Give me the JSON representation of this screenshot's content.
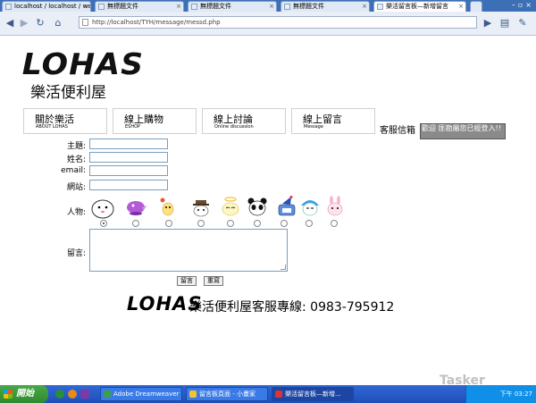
{
  "browser": {
    "tabs": [
      {
        "label": "localhost / localhost / we..."
      },
      {
        "label": "無標題文件"
      },
      {
        "label": "無標題文件"
      },
      {
        "label": "無標題文件"
      },
      {
        "label": "樂活留言板—新增留言"
      }
    ],
    "url": "http://localhost/TYH/message/messd.php"
  },
  "header": {
    "logo": "LOHAS",
    "subtitle": "樂活便利屋"
  },
  "nav": [
    {
      "zh": "關於樂活",
      "en": "ABOUT LOHAS"
    },
    {
      "zh": "線上購物",
      "en": "ESHOP"
    },
    {
      "zh": "線上討論",
      "en": "Online discussion"
    },
    {
      "zh": "線上留言",
      "en": "Message"
    }
  ],
  "mailbox_label": "客服信箱",
  "notice": "歡迎 匪勘屬您已經登入!!",
  "form": {
    "subject_label": "主題:",
    "name_label": "姓名:",
    "email_label": "email:",
    "website_label": "網站:",
    "avatar_label": "人物:",
    "message_label": "留言:",
    "submit_label": "留言",
    "reset_label": "重寫"
  },
  "avatars": [
    "ghost-white-avatar",
    "purple-bird-avatar",
    "yellow-chick-avatar",
    "brown-hat-avatar",
    "angel-face-avatar",
    "panda-avatar",
    "blue-wizard-avatar",
    "blue-hair-avatar",
    "pink-bunny-avatar"
  ],
  "footer": {
    "logo": "LOHAS",
    "hotline": "樂活便利屋客服專線: 0983-795912"
  },
  "taskbar": {
    "start_label": "開始",
    "tasks": [
      {
        "label": "Adobe Dreamweaver ..."
      },
      {
        "label": "留言板頁面 - 小畫家"
      },
      {
        "label": "樂活留言板—新增..."
      }
    ],
    "clock": "下午 03:27"
  },
  "watermark": "Tasker"
}
